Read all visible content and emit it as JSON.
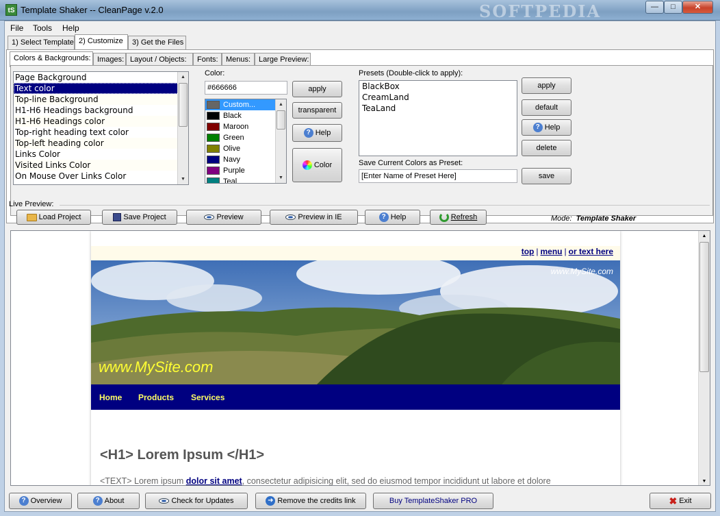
{
  "window": {
    "title": "Template Shaker -- CleanPage v.2.0",
    "icon_text": "tS",
    "watermark": "SOFTPEDIA"
  },
  "menu": [
    "File",
    "Tools",
    "Help"
  ],
  "main_tabs": [
    "1) Select Template",
    "2) Customize",
    "3) Get the Files"
  ],
  "sub_tabs": [
    "Colors & Backgrounds:",
    "Images:",
    "Layout / Objects:",
    "Fonts:",
    "Menus:",
    "Large Preview:"
  ],
  "targets": [
    "Page Background",
    "Text color",
    "Top-line Background",
    "H1-H6 Headings background",
    "H1-H6 Headings color",
    "Top-right heading text color",
    "Top-left heading color",
    "Links Color",
    "Visited Links Color",
    "On Mouse Over Links Color"
  ],
  "color": {
    "label": "Color:",
    "value": "#666666",
    "apply": "apply",
    "transparent": "transparent",
    "help": "Help",
    "picker": "Color",
    "swatches": [
      {
        "name": "Custom...",
        "hex": "#666666"
      },
      {
        "name": "Black",
        "hex": "#000000"
      },
      {
        "name": "Maroon",
        "hex": "#800000"
      },
      {
        "name": "Green",
        "hex": "#008000"
      },
      {
        "name": "Olive",
        "hex": "#808000"
      },
      {
        "name": "Navy",
        "hex": "#000080"
      },
      {
        "name": "Purple",
        "hex": "#800080"
      },
      {
        "name": "Teal",
        "hex": "#008080"
      }
    ]
  },
  "presets": {
    "label": "Presets (Double-click to apply):",
    "items": [
      "BlackBox",
      "CreamLand",
      "TeaLand"
    ],
    "apply": "apply",
    "default": "default",
    "help": "Help",
    "delete": "delete",
    "save_label": "Save Current Colors as Preset:",
    "save_value": "[Enter Name of Preset Here]",
    "save": "save"
  },
  "live_preview_label": "Live Preview:",
  "toolbar": {
    "load": "Load Project",
    "save": "Save Project",
    "preview": "Preview",
    "preview_ie": "Preview in IE",
    "help": "Help",
    "refresh": "Refresh",
    "mode_label": "Mode:",
    "mode_value": "Template Shaker"
  },
  "site": {
    "top_links": [
      "top",
      "menu",
      "or text here"
    ],
    "tagline": "www.MySite.com",
    "brand": "www.MySite.com",
    "nav": [
      "Home",
      "Products",
      "Services"
    ],
    "h1": "<H1> Lorem Ipsum </H1>",
    "para_start": "<TEXT> Lorem ipsum ",
    "para_link": "dolor sit amet",
    "para_end": ", consectetur adipisicing elit, sed do eiusmod tempor incididunt ut labore et dolore"
  },
  "bottom": {
    "overview": "Overview",
    "about": "About",
    "updates": "Check for Updates",
    "credits": "Remove the credits link",
    "buy": "Buy TemplateShaker PRO",
    "exit": "Exit"
  },
  "colors": {
    "selection": "#000080",
    "nav_bg": "#000080",
    "nav_text": "#ffff66",
    "brand_text": "#ffff33"
  }
}
